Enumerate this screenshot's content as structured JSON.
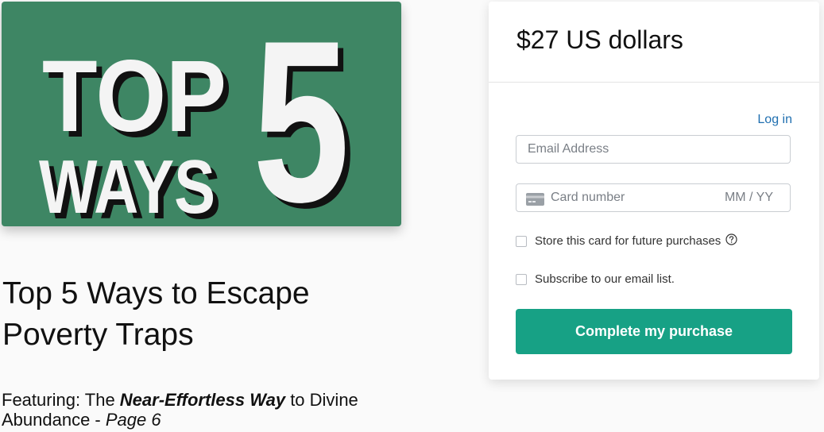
{
  "product": {
    "cover": {
      "line1": "TOP",
      "line2": "WAYS",
      "number": "5",
      "background": "#3e8664"
    },
    "title": "Top 5 Ways to Escape Poverty Traps",
    "featuring": {
      "prefix": "Featuring: The ",
      "emphasis": "Near-Effortless Way",
      "middle": " to Divine Abundance - ",
      "page": "Page 6"
    }
  },
  "checkout": {
    "price": "$27 US dollars",
    "login_label": "Log in",
    "email_placeholder": "Email Address",
    "card_placeholder": "Card number",
    "expiry_placeholder": "MM / YY",
    "store_card_label": "Store this card for future purchases",
    "subscribe_label": "Subscribe to our email list.",
    "submit_label": "Complete my purchase",
    "accent_color": "#17a185",
    "link_color": "#1f6fb0"
  },
  "icons": [
    "credit-card-icon",
    "help-circle-icon"
  ]
}
